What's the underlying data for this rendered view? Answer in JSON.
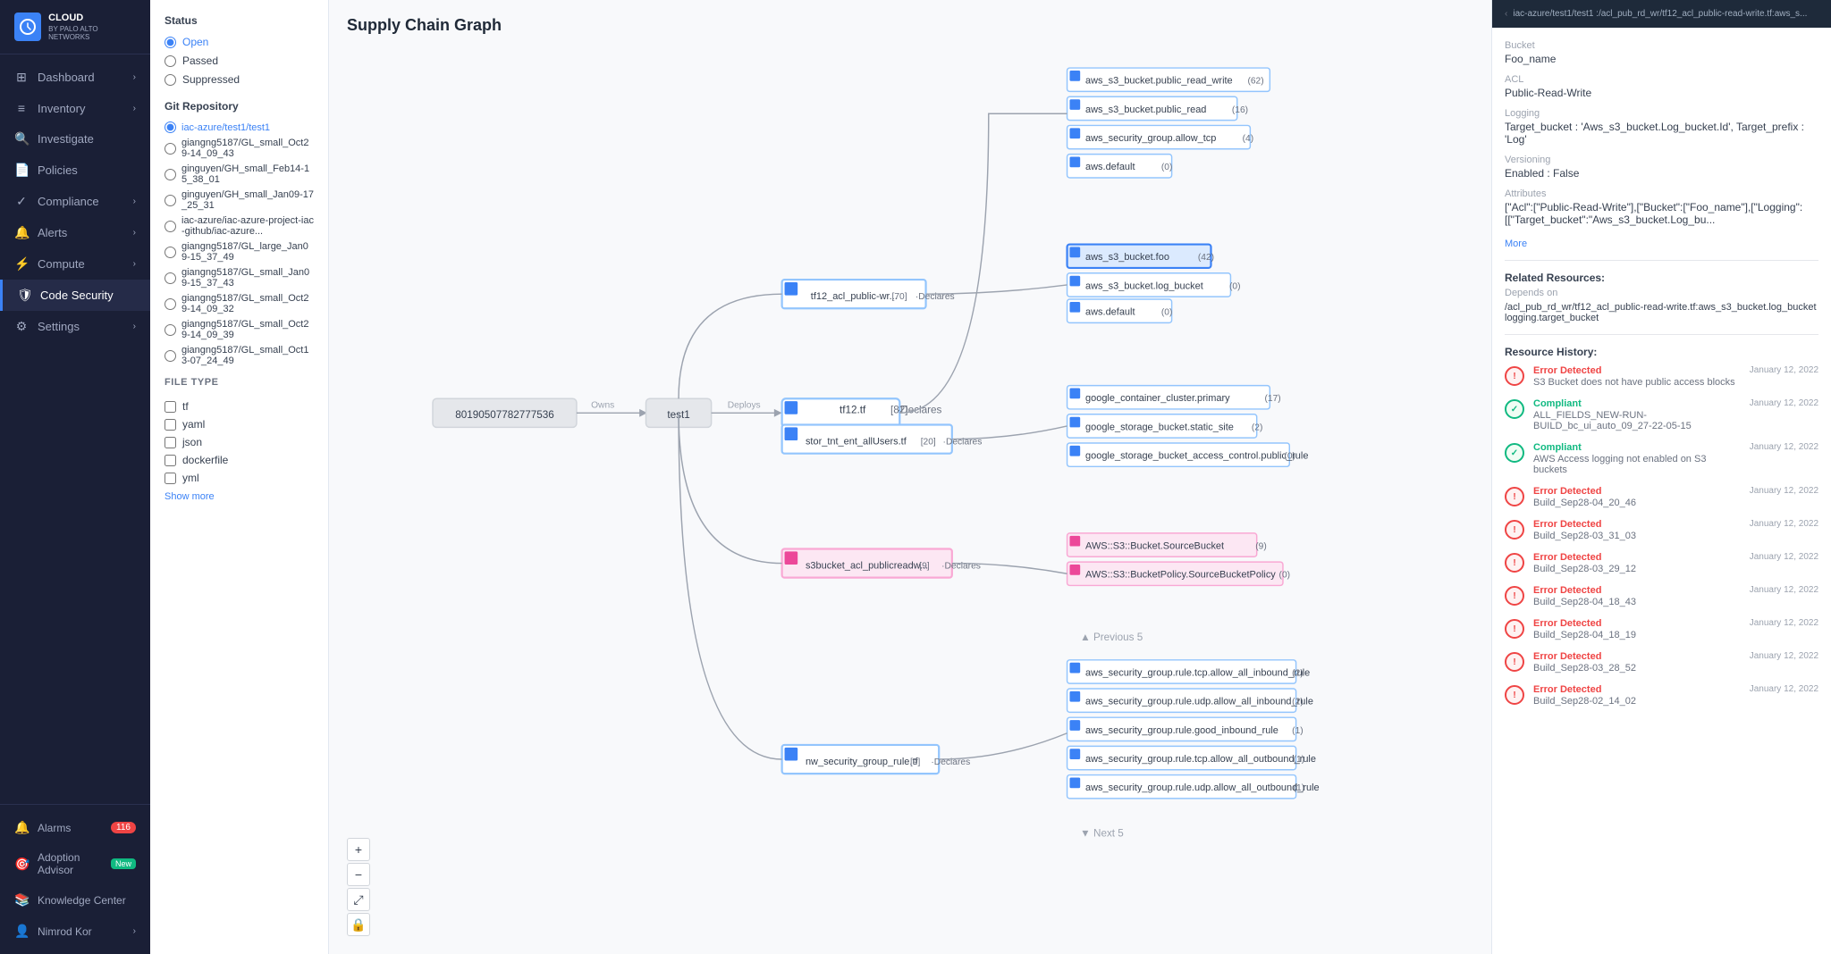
{
  "sidebar": {
    "logo": {
      "line1": "CLOUD",
      "line2": "BY PALO ALTO NETWORKS"
    },
    "items": [
      {
        "id": "dashboard",
        "label": "Dashboard",
        "icon": "⊞",
        "hasChevron": true
      },
      {
        "id": "inventory",
        "label": "Inventory",
        "icon": "≡",
        "hasChevron": true
      },
      {
        "id": "investigate",
        "label": "Investigate",
        "icon": "🔍",
        "hasChevron": false
      },
      {
        "id": "policies",
        "label": "Policies",
        "icon": "📄",
        "hasChevron": false
      },
      {
        "id": "compliance",
        "label": "Compliance",
        "icon": "✓",
        "hasChevron": true
      },
      {
        "id": "alerts",
        "label": "Alerts",
        "icon": "🔔",
        "hasChevron": true
      },
      {
        "id": "compute",
        "label": "Compute",
        "icon": "⚡",
        "hasChevron": true
      },
      {
        "id": "code-security",
        "label": "Code Security",
        "icon": "🛡",
        "hasChevron": false,
        "active": true
      },
      {
        "id": "settings",
        "label": "Settings",
        "icon": "⚙",
        "hasChevron": true
      }
    ],
    "bottom": [
      {
        "id": "alarms",
        "label": "Alarms",
        "icon": "🔔",
        "badge": "116"
      },
      {
        "id": "adoption-advisor",
        "label": "Adoption Advisor",
        "icon": "🎯",
        "badge_new": "New"
      },
      {
        "id": "knowledge-center",
        "label": "Knowledge Center",
        "icon": "📚"
      },
      {
        "id": "nimrod-kor",
        "label": "Nimrod Kor",
        "icon": "👤",
        "hasChevron": true
      }
    ]
  },
  "filter": {
    "status_title": "Status",
    "status_options": [
      {
        "id": "open",
        "label": "Open",
        "checked": true
      },
      {
        "id": "passed",
        "label": "Passed",
        "checked": false
      },
      {
        "id": "suppressed",
        "label": "Suppressed",
        "checked": false
      }
    ],
    "git_title": "Git Repository",
    "git_repos": [
      {
        "label": "iac-azure/test1/test1",
        "checked": true
      },
      {
        "label": "giangng5187/GL_small_Oct29-14_09_43",
        "checked": false
      },
      {
        "label": "ginguyen/GH_small_Feb14-15_38_01",
        "checked": false
      },
      {
        "label": "ginguyen/GH_small_Jan09-17_25_31",
        "checked": false
      },
      {
        "label": "iac-azure/iac-azure-project-iac-github/iac-azure...",
        "checked": false
      },
      {
        "label": "giangng5187/GL_large_Jan09-15_37_49",
        "checked": false
      },
      {
        "label": "giangng5187/GL_small_Jan09-15_37_43",
        "checked": false
      },
      {
        "label": "giangng5187/GL_small_Oct29-14_09_32",
        "checked": false
      },
      {
        "label": "giangng5187/GL_small_Oct29-14_09_39",
        "checked": false
      },
      {
        "label": "giangng5187/GL_small_Oct13-07_24_49",
        "checked": false
      }
    ],
    "file_type_title": "FILE TYPE",
    "file_types": [
      {
        "label": "tf",
        "checked": false
      },
      {
        "label": "yaml",
        "checked": false
      },
      {
        "label": "json",
        "checked": false
      },
      {
        "label": "dockerfile",
        "checked": false
      },
      {
        "label": "yml",
        "checked": false
      }
    ],
    "show_more": "Show more"
  },
  "graph": {
    "title": "Supply Chain Graph",
    "nodes": {
      "account": "80190507782777536",
      "test1": "test1",
      "tf12": "tf12.tf  [82]",
      "tf12_acl": "tf12_acl_public-wr... [70]",
      "stor_tnt_ent": "stor_tnt_ent_allUsers.tf  [20]",
      "s3bucket_acl": "s3bucket_acl_publicreadw... [9]",
      "nw_security": "nw_security_group_rule.tf  [9]"
    }
  },
  "right_panel": {
    "header_path": "iac-azure/test1/test1 :/acl_pub_rd_wr/tf12_acl_public-read-write.tf:aws_s...",
    "bucket_label": "Bucket",
    "bucket_value": "Foo_name",
    "acl_label": "ACL",
    "acl_value": "Public-Read-Write",
    "logging_label": "Logging",
    "logging_value": "Target_bucket : 'Aws_s3_bucket.Log_bucket.Id', Target_prefix : 'Log'",
    "versioning_label": "Versioning",
    "versioning_value": "Enabled : False",
    "attributes_label": "Attributes",
    "attributes_value": "[\"Acl\":[\"Public-Read-Write\"],[\"Bucket\":[\"Foo_name\"],[\"Logging\":[[\"Target_bucket\":\"Aws_s3_bucket.Log_bu...",
    "more_label": "More",
    "related_title": "Related Resources:",
    "depends_on_label": "Depends on",
    "depends_on_value": "/acl_pub_rd_wr/tf12_acl_public-read-write.tf:aws_s3_bucket.log_bucket\nlogging.target_bucket",
    "history_title": "Resource History:",
    "history_items": [
      {
        "type": "error",
        "status": "Error Detected",
        "date": "January 12, 2022",
        "desc": "S3 Bucket does not have public access blocks"
      },
      {
        "type": "compliant",
        "status": "Compliant",
        "date": "January 12, 2022",
        "desc": "ALL_FIELDS_NEW-RUN-BUILD_bc_ui_auto_09_27-22-05-15"
      },
      {
        "type": "compliant",
        "status": "Compliant",
        "date": "January 12, 2022",
        "desc": "AWS Access logging not enabled on S3 buckets"
      },
      {
        "type": "error",
        "status": "Error Detected",
        "date": "January 12, 2022",
        "desc": "Build_Sep28-04_20_46"
      },
      {
        "type": "error",
        "status": "Error Detected",
        "date": "January 12, 2022",
        "desc": "Build_Sep28-03_31_03"
      },
      {
        "type": "error",
        "status": "Error Detected",
        "date": "January 12, 2022",
        "desc": "Build_Sep28-03_29_12"
      },
      {
        "type": "error",
        "status": "Error Detected",
        "date": "January 12, 2022",
        "desc": "Build_Sep28-04_18_43"
      },
      {
        "type": "error",
        "status": "Error Detected",
        "date": "January 12, 2022",
        "desc": "Build_Sep28-04_18_19"
      },
      {
        "type": "error",
        "status": "Error Detected",
        "date": "January 12, 2022",
        "desc": "Build_Sep28-03_28_52"
      },
      {
        "type": "error",
        "status": "Error Detected",
        "date": "January 12, 2022",
        "desc": "Build_Sep28-02_14_02"
      }
    ]
  }
}
